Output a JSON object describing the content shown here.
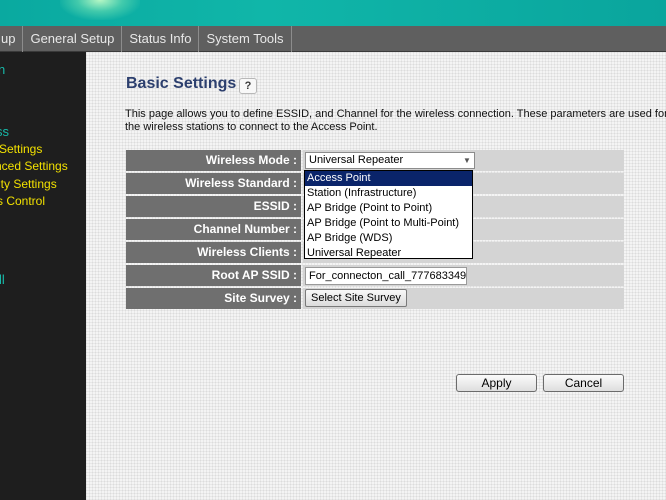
{
  "menu": {
    "items": [
      "up",
      "General Setup",
      "Status Info",
      "System Tools"
    ]
  },
  "sidebar": {
    "items": [
      {
        "label": "n",
        "style": "teal"
      },
      {
        "label": "ss",
        "style": "teal"
      },
      {
        "label": "Settings",
        "style": "yellow"
      },
      {
        "label": "nced Settings",
        "style": "yellow"
      },
      {
        "label": "ity Settings",
        "style": "yellow"
      },
      {
        "label": "s Control",
        "style": "yellow"
      },
      {
        "label": "ll",
        "style": "teal"
      }
    ]
  },
  "page": {
    "title": "Basic Settings",
    "help_icon": "help-question-icon",
    "help_glyph": "?",
    "description": "This page allows you to define ESSID, and Channel for the wireless connection. These parameters are used for the wireless stations to connect to the Access Point."
  },
  "form": {
    "rows": [
      {
        "label": "Wireless Mode :",
        "control": "select",
        "value": "Universal Repeater"
      },
      {
        "label": "Wireless Standard :",
        "control": "none",
        "value": ""
      },
      {
        "label": "ESSID :",
        "control": "none",
        "value": ""
      },
      {
        "label": "Channel Number :",
        "control": "none",
        "value": ""
      },
      {
        "label": "Wireless Clients :",
        "control": "none",
        "value": ""
      },
      {
        "label": "Root AP SSID :",
        "control": "input",
        "value": "For_connecton_call_777683349"
      },
      {
        "label": "Site Survey :",
        "control": "button",
        "value": "Select Site Survey"
      }
    ],
    "dropdown_options": [
      "Access Point",
      "Station (Infrastructure)",
      "AP Bridge (Point to Point)",
      "AP Bridge (Point to Multi-Point)",
      "AP Bridge (WDS)",
      "Universal Repeater"
    ],
    "highlighted_option": "Access Point"
  },
  "actions": {
    "apply_label": "Apply",
    "cancel_label": "Cancel"
  },
  "colors": {
    "banner": "#10b6a9",
    "menubar": "#5f5f5f",
    "sidebar": "#1e1e1e",
    "sidebar_teal": "#17b9a9",
    "sidebar_yellow": "#f2e100",
    "title": "#2c3f6e",
    "label_bg": "#6f6f6f",
    "cell_bg": "#d4d4d4",
    "selected_option_bg": "#0a246a"
  }
}
